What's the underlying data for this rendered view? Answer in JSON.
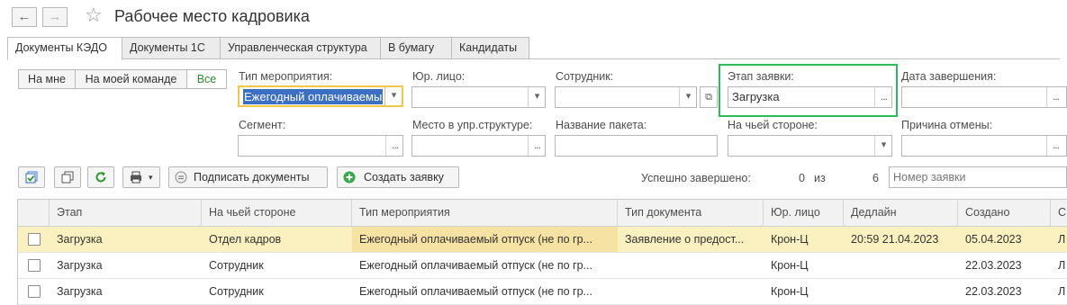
{
  "title": "Рабочее место кадровика",
  "nav": {
    "back_icon": "arrow-left-icon",
    "forward_icon": "arrow-right-icon",
    "favorite_icon": "star-icon"
  },
  "tabs": [
    {
      "label": "Документы КЭДО",
      "active": true
    },
    {
      "label": "Документы 1С",
      "active": false
    },
    {
      "label": "Управленческая структура",
      "active": false
    },
    {
      "label": "В бумагу",
      "active": false
    },
    {
      "label": "Кандидаты",
      "active": false
    }
  ],
  "filter_buttons": [
    {
      "label": "На мне",
      "active": false
    },
    {
      "label": "На моей команде",
      "active": false
    },
    {
      "label": "Все",
      "active": true
    }
  ],
  "filters": {
    "event_type": {
      "label": "Тип мероприятия:",
      "value": "Ежегодный оплачиваемы"
    },
    "legal_entity": {
      "label": "Юр. лицо:",
      "value": ""
    },
    "employee": {
      "label": "Сотрудник:",
      "value": ""
    },
    "request_stage": {
      "label": "Этап заявки:",
      "value": "Загрузка"
    },
    "completion_date": {
      "label": "Дата завершения:",
      "value": ""
    },
    "segment": {
      "label": "Сегмент:",
      "value": ""
    },
    "org_place": {
      "label": "Место в упр.структуре:",
      "value": ""
    },
    "package_name": {
      "label": "Название пакета:",
      "value": ""
    },
    "whose_side": {
      "label": "На чьей стороне:",
      "value": ""
    },
    "cancel_reason": {
      "label": "Причина отмены:",
      "value": ""
    }
  },
  "toolbar": {
    "sign_label": "Подписать документы",
    "create_label": "Создать заявку",
    "success_label": "Успешно завершено:",
    "success_count": "0",
    "of_label": "из",
    "total_count": "6",
    "request_number_placeholder": "Номер заявки"
  },
  "table": {
    "columns": [
      "Этап",
      "На чьей стороне",
      "Тип мероприятия",
      "Тип документа",
      "Юр. лицо",
      "Дедлайн",
      "Создано",
      "С"
    ],
    "rows": [
      {
        "stage": "Загрузка",
        "side": "Отдел кадров",
        "event": "Ежегодный оплачиваемый отпуск (не по гр...",
        "doc": "Заявление о предост...",
        "entity": "Крон-Ц",
        "deadline": "20:59 21.04.2023",
        "created": "05.04.2023",
        "extra": "Л",
        "selected": true
      },
      {
        "stage": "Загрузка",
        "side": "Сотрудник",
        "event": "Ежегодный оплачиваемый отпуск (не по гр...",
        "doc": "",
        "entity": "Крон-Ц",
        "deadline": "",
        "created": "22.03.2023",
        "extra": "Л",
        "selected": false
      },
      {
        "stage": "Загрузка",
        "side": "Сотрудник",
        "event": "Ежегодный оплачиваемый отпуск (не по гр...",
        "doc": "",
        "entity": "Крон-Ц",
        "deadline": "",
        "created": "22.03.2023",
        "extra": "Л",
        "selected": false
      }
    ]
  },
  "colors": {
    "highlight_yellow": "#f2c744",
    "highlight_green": "#2dbb5a",
    "selected_row": "#fbf0bf",
    "active_green_text": "#2d8a2d"
  }
}
